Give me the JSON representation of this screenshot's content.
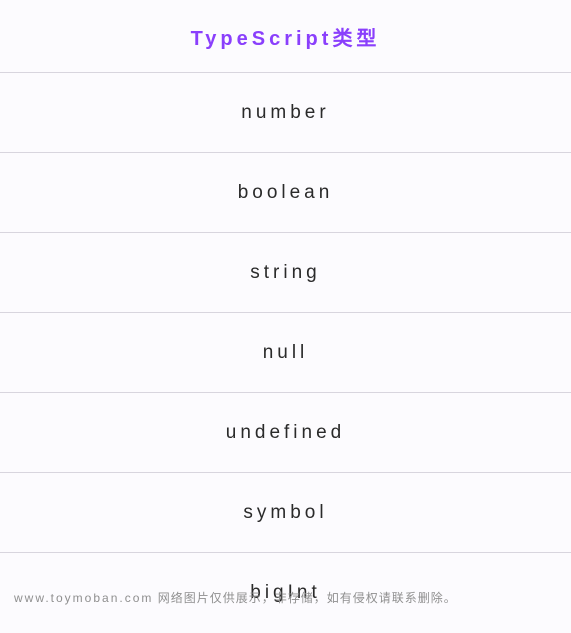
{
  "header": {
    "title": "TypeScript类型"
  },
  "rows": [
    {
      "label": "number"
    },
    {
      "label": "boolean"
    },
    {
      "label": "string"
    },
    {
      "label": "null"
    },
    {
      "label": "undefined"
    },
    {
      "label": "symbol"
    },
    {
      "label": "bigInt"
    }
  ],
  "watermark": {
    "domain": "www.toymoban.com",
    "text": " 网络图片仅供展示，非存储，如有侵权请联系删除。"
  }
}
